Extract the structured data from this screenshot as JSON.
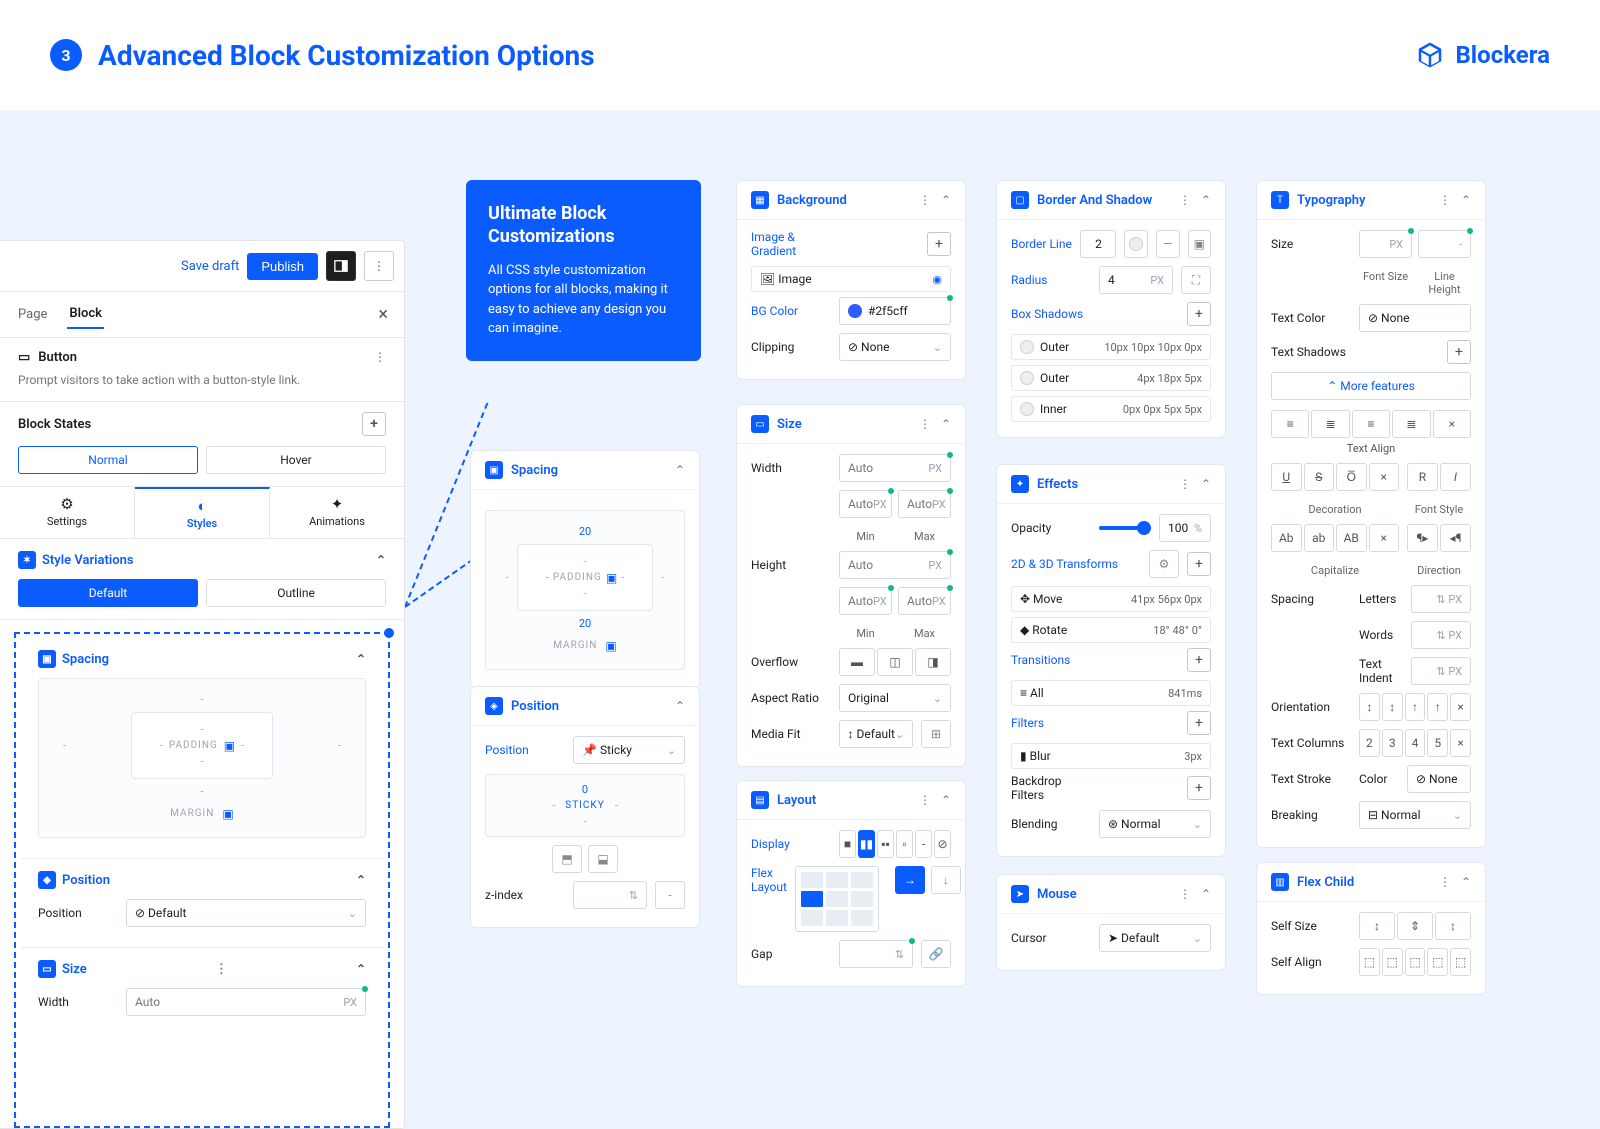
{
  "header": {
    "step": "3",
    "title": "Advanced Block Customization Options",
    "brand": "Blockera"
  },
  "editor": {
    "save_draft": "Save draft",
    "publish": "Publish",
    "tabs": {
      "page": "Page",
      "block": "Block"
    },
    "button_block": {
      "name": "Button",
      "desc": "Prompt visitors to take action with a button-style link."
    },
    "block_states": "Block States",
    "normal": "Normal",
    "hover": "Hover",
    "settings": "Settings",
    "styles": "Styles",
    "animations": "Animations",
    "style_variations": "Style Variations",
    "default": "Default",
    "outline": "Outline",
    "spacing": "Spacing",
    "position": "Position",
    "position_val": "Default",
    "size": "Size",
    "width": "Width",
    "auto": "Auto",
    "px": "PX",
    "padding": "PADDING",
    "margin": "MARGIN"
  },
  "callout": {
    "title": "Ultimate Block Customizations",
    "body": "All CSS style customization options for all blocks, making it easy to achieve any design you can imagine."
  },
  "spacing_card": {
    "title": "Spacing",
    "top": "20",
    "bottom": "20",
    "padding": "PADDING",
    "margin": "MARGIN"
  },
  "position_card": {
    "title": "Position",
    "label": "Position",
    "value": "Sticky",
    "zero": "0",
    "sticky": "STICKY",
    "zindex": "z-index"
  },
  "background": {
    "title": "Background",
    "image_gradient": "Image & Gradient",
    "image": "Image",
    "bg_color": "BG Color",
    "color_val": "#2f5cff",
    "clipping": "Clipping",
    "none": "None"
  },
  "size": {
    "title": "Size",
    "width": "Width",
    "height": "Height",
    "auto": "Auto",
    "px": "PX",
    "min": "Min",
    "max": "Max",
    "overflow": "Overflow",
    "aspect": "Aspect Ratio",
    "original": "Original",
    "media_fit": "Media Fit",
    "default": "Default"
  },
  "layout": {
    "title": "Layout",
    "display": "Display",
    "flex_layout": "Flex Layout",
    "gap": "Gap"
  },
  "border": {
    "title": "Border And Shadow",
    "border_line": "Border Line",
    "line_val": "2",
    "radius": "Radius",
    "radius_val": "4",
    "px": "PX",
    "box_shadows": "Box Shadows",
    "shadows": [
      {
        "type": "Outer",
        "vals": "10px 10px 10px 0px"
      },
      {
        "type": "Outer",
        "vals": "4px 18px 5px"
      },
      {
        "type": "Inner",
        "vals": "0px 0px 5px 5px"
      }
    ]
  },
  "effects": {
    "title": "Effects",
    "opacity": "Opacity",
    "opacity_val": "100",
    "pct": "%",
    "transforms": "2D & 3D Transforms",
    "move": "Move",
    "move_vals": "41px 56px 0px",
    "rotate": "Rotate",
    "rotate_vals": "18° 48° 0°",
    "transitions": "Transitions",
    "all": "All",
    "all_time": "841ms",
    "filters": "Filters",
    "blur": "Blur",
    "blur_val": "3px",
    "backdrop": "Backdrop Filters",
    "blending": "Blending",
    "normal": "Normal"
  },
  "mouse": {
    "title": "Mouse",
    "cursor": "Cursor",
    "default": "Default"
  },
  "typography": {
    "title": "Typography",
    "size": "Size",
    "font_size": "Font Size",
    "line_height": "Line Height",
    "px": "PX",
    "text_color": "Text Color",
    "none": "None",
    "text_shadows": "Text Shadows",
    "more": "More features",
    "text_align": "Text Align",
    "decoration": "Decoration",
    "font_style": "Font Style",
    "capitalize": "Capitalize",
    "direction": "Direction",
    "spacing": "Spacing",
    "letters": "Letters",
    "words": "Words",
    "text_indent": "Text Indent",
    "orientation": "Orientation",
    "text_columns": "Text Columns",
    "cols": [
      "2",
      "3",
      "4",
      "5"
    ],
    "text_stroke": "Text Stroke",
    "color": "Color",
    "breaking": "Breaking",
    "normal": "Normal"
  },
  "flex_child": {
    "title": "Flex Child",
    "self_size": "Self Size",
    "self_align": "Self Align"
  }
}
